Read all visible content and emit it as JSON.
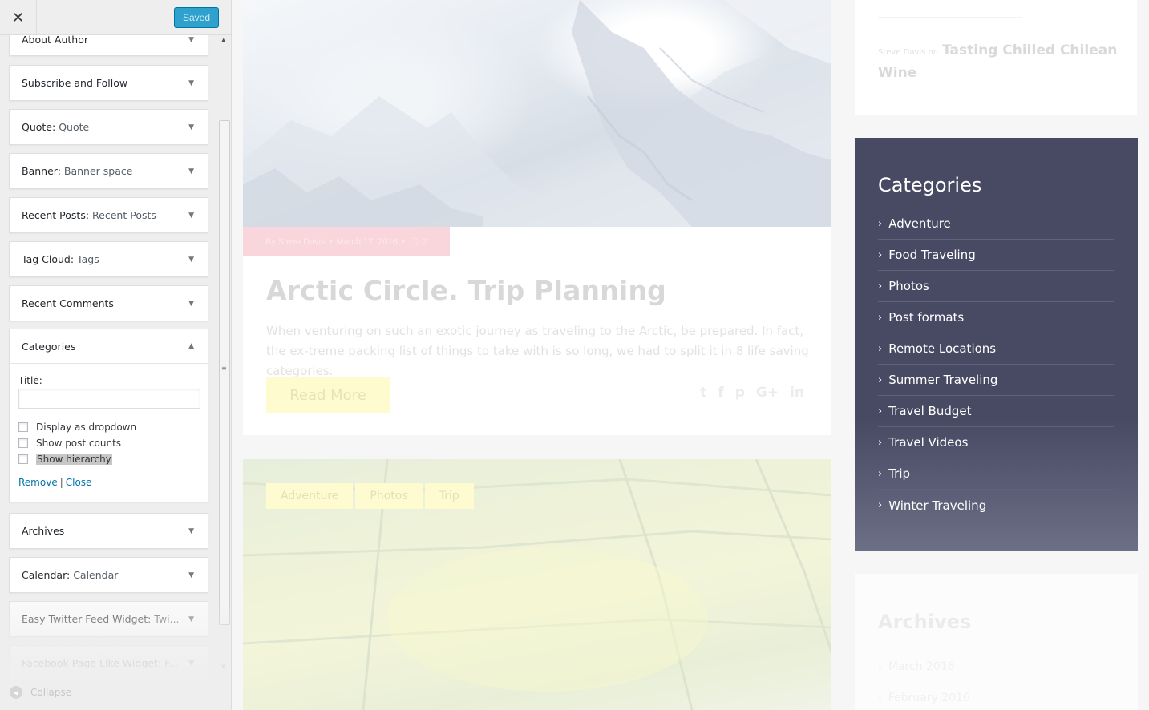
{
  "customizer": {
    "close_icon": "close-icon",
    "saved_label": "Saved",
    "collapse_label": "Collapse",
    "widgets": [
      {
        "name": "About Author",
        "sub": ""
      },
      {
        "name": "Subscribe and Follow",
        "sub": ""
      },
      {
        "name": "Quote:",
        "sub": "Quote"
      },
      {
        "name": "Banner:",
        "sub": "Banner space"
      },
      {
        "name": "Recent Posts:",
        "sub": "Recent Posts"
      },
      {
        "name": "Tag Cloud:",
        "sub": "Tags"
      },
      {
        "name": "Recent Comments",
        "sub": ""
      },
      {
        "name": "Categories",
        "sub": ""
      },
      {
        "name": "Archives",
        "sub": ""
      },
      {
        "name": "Calendar:",
        "sub": "Calendar"
      },
      {
        "name": "Easy Twitter Feed Widget:",
        "sub": "Twi..."
      },
      {
        "name": "Facebook Page Like Widget:",
        "sub": "F..."
      }
    ],
    "categories_form": {
      "title_label": "Title:",
      "title_value": "",
      "options": [
        {
          "label": "Display as dropdown",
          "checked": false
        },
        {
          "label": "Show post counts",
          "checked": false
        },
        {
          "label": "Show hierarchy",
          "checked": false
        }
      ],
      "remove_label": "Remove",
      "separator": "|",
      "close_label": "Close"
    }
  },
  "preview": {
    "post": {
      "meta_author": "By Steve Davis",
      "meta_date": "March 17, 2016",
      "meta_comments": "2",
      "title": "Arctic Circle. Trip Planning",
      "excerpt": "When venturing on such an exotic journey as traveling to the Arctic, be prepared. In fact, the ex-treme packing list of things to take with is so long, we had to split it in 8 life saving categories.",
      "read_more": "Read More",
      "social": [
        "twitter-icon",
        "facebook-icon",
        "pinterest-icon",
        "google-plus-icon",
        "linkedin-icon"
      ]
    },
    "tags": [
      "Adventure",
      "Photos",
      "Trip"
    ],
    "recent_comment": {
      "by": "Steve Davis on",
      "post": "Tasting Chilled Chilean Wine"
    },
    "categories": {
      "title": "Categories",
      "items": [
        "Adventure",
        "Food Traveling",
        "Photos",
        "Post formats",
        "Remote Locations",
        "Summer Traveling",
        "Travel Budget",
        "Travel Videos",
        "Trip",
        "Winter Traveling"
      ],
      "bg_color": "#484a63"
    },
    "archives": {
      "title": "Archives",
      "items": [
        "March 2016",
        "February 2016"
      ]
    }
  }
}
